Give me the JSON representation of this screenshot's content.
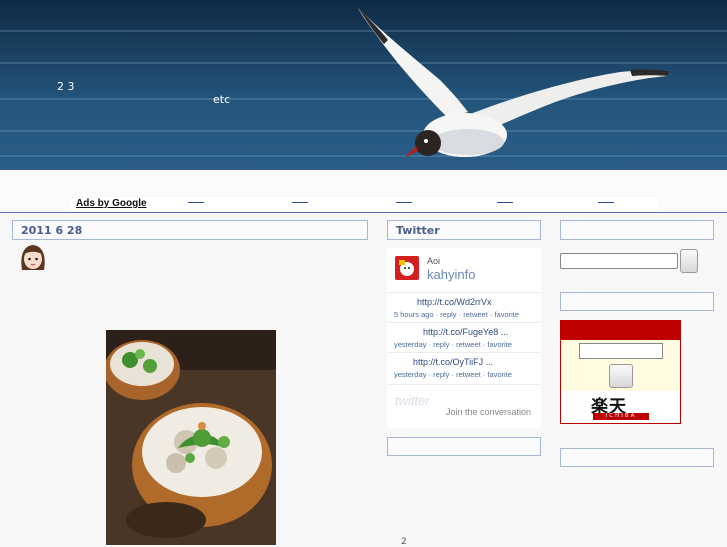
{
  "header": {
    "text_nums": "2 3",
    "text_etc": "etc"
  },
  "ads": {
    "label": "Ads by Google",
    "link_count": 5
  },
  "post": {
    "date": "2011 6 28"
  },
  "twitter_widget": {
    "title": "Twitter",
    "display_name": "Aoi",
    "username": "kahyinfo",
    "tweets": [
      {
        "link": "http://t.co/Wd2rrVx",
        "meta": "5 hours ago · reply · retweet · favorite"
      },
      {
        "link": "http://t.co/FugeYe8     ...",
        "meta": "yesterday · reply · retweet · favorite"
      },
      {
        "link": "http://t.co/OyTiiFJ       ...",
        "meta": "yesterday · reply · retweet · favorite"
      }
    ],
    "join_text": "Join the conversation"
  },
  "rakuten": {
    "kanji": "楽天",
    "sub": "ICHIBA"
  },
  "footer": {
    "page_num": "2"
  },
  "colors": {
    "accent": "#5b74b8",
    "rakuten_red": "#bf0000",
    "panel_border": "#a9b7d6"
  }
}
